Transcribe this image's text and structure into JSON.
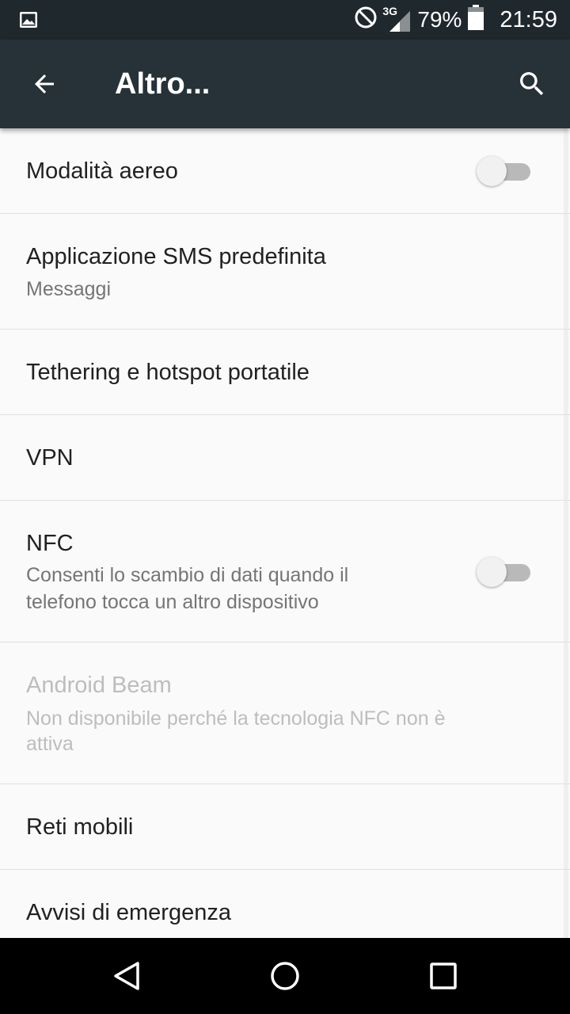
{
  "status_bar": {
    "icons": [
      "image-notification-icon",
      "do-not-disturb-icon",
      "signal-3g-icon",
      "battery-icon"
    ],
    "network_type": "3G",
    "battery": "79%",
    "time": "21:59"
  },
  "app_bar": {
    "title": "Altro..."
  },
  "settings": {
    "airplane": {
      "title": "Modalità aereo",
      "enabled": false
    },
    "sms": {
      "title": "Applicazione SMS predefinita",
      "summary": "Messaggi"
    },
    "tethering": {
      "title": "Tethering e hotspot portatile"
    },
    "vpn": {
      "title": "VPN"
    },
    "nfc": {
      "title": "NFC",
      "summary_line1": "Consenti lo scambio di dati quando il",
      "summary_line2": "telefono tocca un altro dispositivo",
      "enabled": false
    },
    "beam": {
      "title": "Android Beam",
      "summary_line1": "Non disponibile perché la tecnologia NFC non è",
      "summary_line2": "attiva"
    },
    "mobile": {
      "title": "Reti mobili"
    },
    "emergency": {
      "title": "Avvisi di emergenza"
    }
  },
  "colors": {
    "status_bar": "#1f282d",
    "app_bar": "#263238",
    "background": "#fafafa",
    "text_primary": "#212121",
    "text_secondary": "#757575",
    "text_disabled": "#bdbdbd"
  }
}
